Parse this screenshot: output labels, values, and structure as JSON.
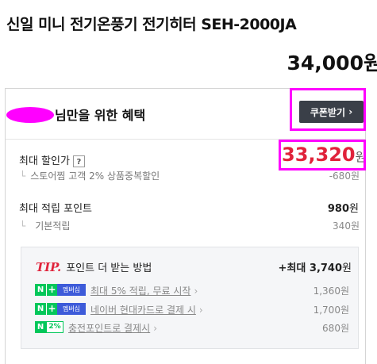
{
  "product": {
    "title": "신일 미니 전기온풍기 전기히터 SEH-2000JA",
    "price": "34,000",
    "price_unit": "원"
  },
  "benefit": {
    "heading_suffix": "님만을 위한 혜택",
    "coupon_button": "쿠폰받기",
    "coupon_chevron": "›",
    "max_discount": {
      "label": "최대 할인가",
      "help_icon": "?",
      "price": "33,320",
      "unit": "원",
      "sub_label": "스토어찜 고객 2% 상품중복할인",
      "sub_value": "-680원"
    },
    "max_points": {
      "label": "최대 적립 포인트",
      "value": "980",
      "unit": "원",
      "sub_label": "기본적립",
      "sub_value": "340원"
    }
  },
  "tip": {
    "tag": "TIP.",
    "title": "포인트 더 받는 방법",
    "total_prefix": "+최대",
    "total_value": "3,740",
    "total_unit": "원",
    "items": [
      {
        "badge_n": "N",
        "badge_plus": "+",
        "badge_member": "멤버십",
        "label": "최대 5% 적립, 무료 시작",
        "value": "1,360원"
      },
      {
        "badge_n": "N",
        "badge_plus": "+",
        "badge_member": "멤버십",
        "label": "네이버 현대카드로 결제 시",
        "value": "1,700원"
      },
      {
        "badge_n": "N",
        "badge_pct": "2%",
        "label": "충전포인트로 결제시",
        "value": "680원"
      }
    ]
  },
  "colors": {
    "accent_red": "#e0233b",
    "naver_green": "#03c75a",
    "member_blue": "#3d5bd9",
    "highlight": "#ff00ff"
  }
}
